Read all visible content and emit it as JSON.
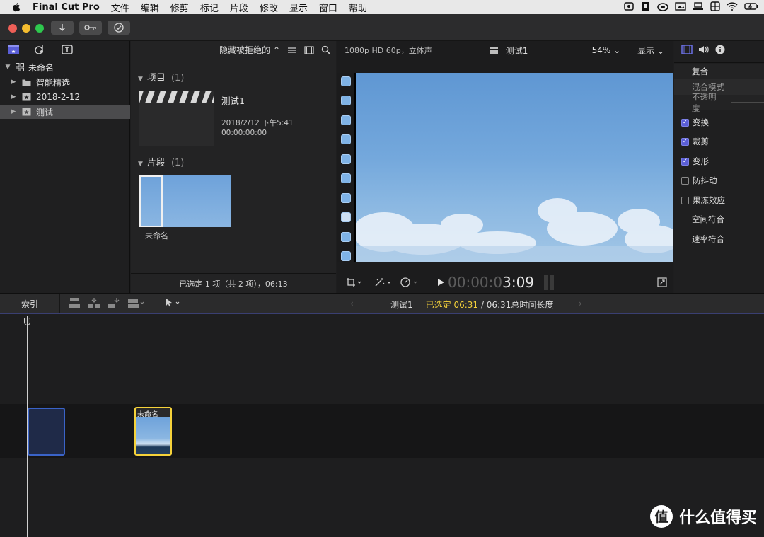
{
  "menubar": {
    "app_name": "Final Cut Pro",
    "menus": [
      "文件",
      "编辑",
      "修剪",
      "标记",
      "片段",
      "修改",
      "显示",
      "窗口",
      "帮助"
    ]
  },
  "toolbar": {
    "import_icon": "download-arrow-icon",
    "keywords_icon": "key-icon",
    "background_tasks_icon": "checkmark-circle-icon"
  },
  "library": {
    "name": "未命名",
    "items": [
      {
        "label": "智能精选",
        "icon": "folder-icon",
        "selected": false
      },
      {
        "label": "2018-2-12",
        "icon": "star-event-icon",
        "selected": false
      },
      {
        "label": "测试",
        "icon": "star-event-icon",
        "selected": true
      }
    ]
  },
  "browser": {
    "filter_label": "隐藏被拒绝的",
    "projects_title": "项目",
    "projects_count": "(1)",
    "project": {
      "name": "测试1",
      "date": "2018/2/12 下午5:41",
      "duration": "00:00:00:00"
    },
    "clips_title": "片段",
    "clips_count": "(1)",
    "clip": {
      "name": "未命名"
    },
    "footer": "已选定 1 项（共 2 项），06:13"
  },
  "viewer": {
    "format": "1080p HD 60p，立体声",
    "project_name": "测试1",
    "zoom": "54%",
    "display_label": "显示",
    "timecode_dim": "00:00:0",
    "timecode_bright": "3:09"
  },
  "inspector": {
    "rows": [
      {
        "label": "复合",
        "type": "header"
      },
      {
        "label": "混合模式",
        "type": "dim"
      },
      {
        "label": "不透明度",
        "type": "dim"
      },
      {
        "label": "变换",
        "type": "check",
        "checked": true
      },
      {
        "label": "裁剪",
        "type": "check",
        "checked": true
      },
      {
        "label": "变形",
        "type": "check",
        "checked": true
      },
      {
        "label": "防抖动",
        "type": "check",
        "checked": false
      },
      {
        "label": "果冻效应",
        "type": "check",
        "checked": false
      },
      {
        "label": "空间符合",
        "type": "plain"
      },
      {
        "label": "速率符合",
        "type": "plain"
      }
    ]
  },
  "timeline_bar": {
    "index_label": "索引",
    "project_name": "测试1",
    "selected_label": "已选定 06:31",
    "total_label": "/ 06:31总时间长度"
  },
  "timeline": {
    "clip_name": "未命名"
  },
  "watermark": {
    "text": "什么值得买",
    "logo_char": "值"
  },
  "colors": {
    "accent_purple": "#5a5ed6",
    "selection_yellow": "#f5d23a",
    "timeline_blue": "#3a63c8"
  }
}
